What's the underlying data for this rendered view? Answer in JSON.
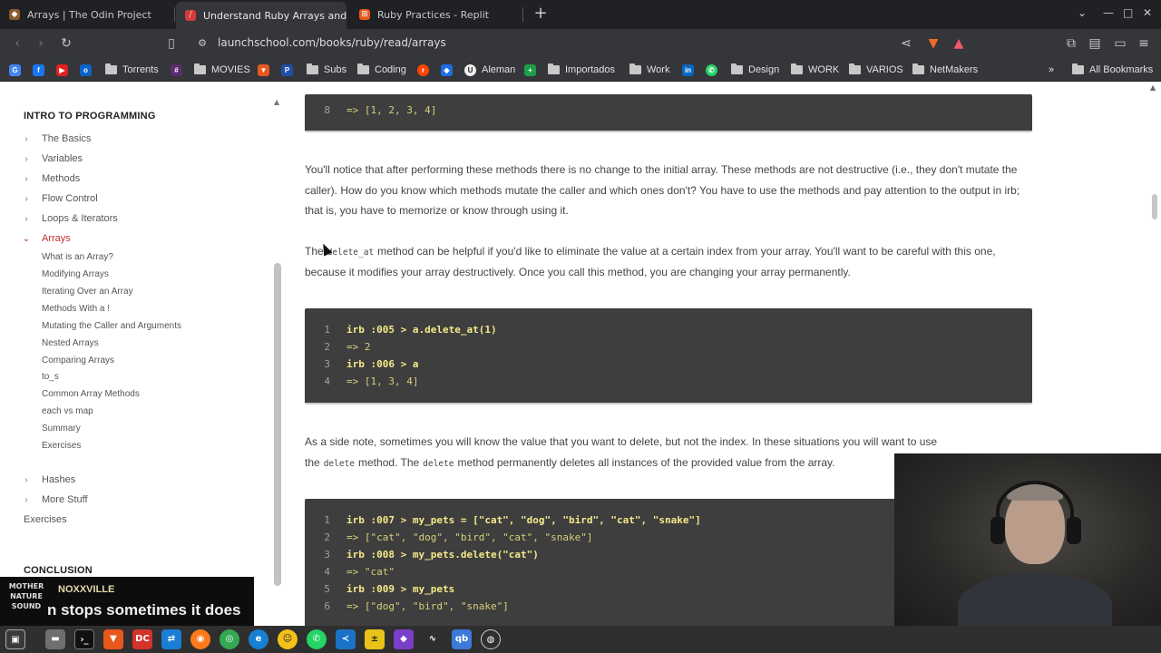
{
  "browser": {
    "tabs": [
      {
        "title": "Arrays | The Odin Project",
        "active": false
      },
      {
        "title": "Understand Ruby Arrays and",
        "active": true
      },
      {
        "title": "Ruby Practices - Replit",
        "active": false
      }
    ],
    "url": "launchschool.com/books/ruby/read/arrays",
    "bookmarks": [
      "Torrents",
      "MOVIES",
      "Subs",
      "Coding",
      "Aleman",
      "Importados",
      "Work",
      "Design",
      "WORK",
      "VARIOS",
      "NetMakers"
    ],
    "all_bookmarks": "All Bookmarks",
    "more_bookmarks": "»"
  },
  "sidebar": {
    "heading": "INTRO TO PROGRAMMING",
    "items": [
      {
        "label": "The Basics"
      },
      {
        "label": "Variables"
      },
      {
        "label": "Methods"
      },
      {
        "label": "Flow Control"
      },
      {
        "label": "Loops & Iterators"
      },
      {
        "label": "Arrays"
      }
    ],
    "subitems": [
      "What is an Array?",
      "Modifying Arrays",
      "Iterating Over an Array",
      "Methods With a !",
      "Mutating the Caller and Arguments",
      "Nested Arrays",
      "Comparing Arrays",
      "to_s",
      "Common Array Methods",
      "each vs map",
      "Summary",
      "Exercises"
    ],
    "items_after": [
      {
        "label": "Hashes"
      },
      {
        "label": "More Stuff"
      }
    ],
    "exercises": "Exercises",
    "conclusion": "CONCLUSION"
  },
  "content": {
    "code_top": {
      "line": "8",
      "text": "=> [1, 2, 3, 4]"
    },
    "para1": "You'll notice that after performing these methods there is no change to the initial array. These methods are not destructive (i.e., they don't mutate the caller). How do you know which methods mutate the caller and which ones don't? You have to use the methods and pay attention to the output in irb; that is, you have to memorize or know through using it.",
    "para2_before": "The",
    "para2_code": "delete_at",
    "para2_after": "method can be helpful if you'd like to eliminate the value at a certain index from your array. You'll want to be careful with this one, because it modifies your array destructively. Once you call this method, you are changing your array permanently.",
    "code1": [
      {
        "n": "1",
        "t": "irb :005 > a.delete_at(1)",
        "kind": "in"
      },
      {
        "n": "2",
        "t": "=> 2",
        "kind": "out"
      },
      {
        "n": "3",
        "t": "irb :006 > a",
        "kind": "in"
      },
      {
        "n": "4",
        "t": "=> [1, 3, 4]",
        "kind": "out"
      }
    ],
    "para3_a": "As a side note, sometimes you will know the value that you want to delete, but not the index. In these situations you will want to use the",
    "para3_code1": "delete",
    "para3_b": "method. The",
    "para3_code2": "delete",
    "para3_c": "method permanently deletes all instances of the provided value from the array.",
    "code2": [
      {
        "n": "1",
        "t": "irb :007 > my_pets = [\"cat\", \"dog\", \"bird\", \"cat\", \"snake\"]",
        "kind": "in"
      },
      {
        "n": "2",
        "t": "=> [\"cat\", \"dog\", \"bird\", \"cat\", \"snake\"]",
        "kind": "out"
      },
      {
        "n": "3",
        "t": "irb :008 > my_pets.delete(\"cat\")",
        "kind": "in"
      },
      {
        "n": "4",
        "t": "=> \"cat\"",
        "kind": "out"
      },
      {
        "n": "5",
        "t": "irb :009 > my_pets",
        "kind": "in"
      },
      {
        "n": "6",
        "t": "=> [\"dog\", \"bird\", \"snake\"]",
        "kind": "out"
      }
    ]
  },
  "overlay": {
    "ticker_logo": "MOTHER NATURE SOUND",
    "ticker_name": "NOXXVILLE",
    "ticker_msg": "n stops sometimes it does"
  },
  "colors": {
    "accent": "#c03030",
    "code_bg": "#3e3e3e",
    "code_text": "#e6db74"
  }
}
